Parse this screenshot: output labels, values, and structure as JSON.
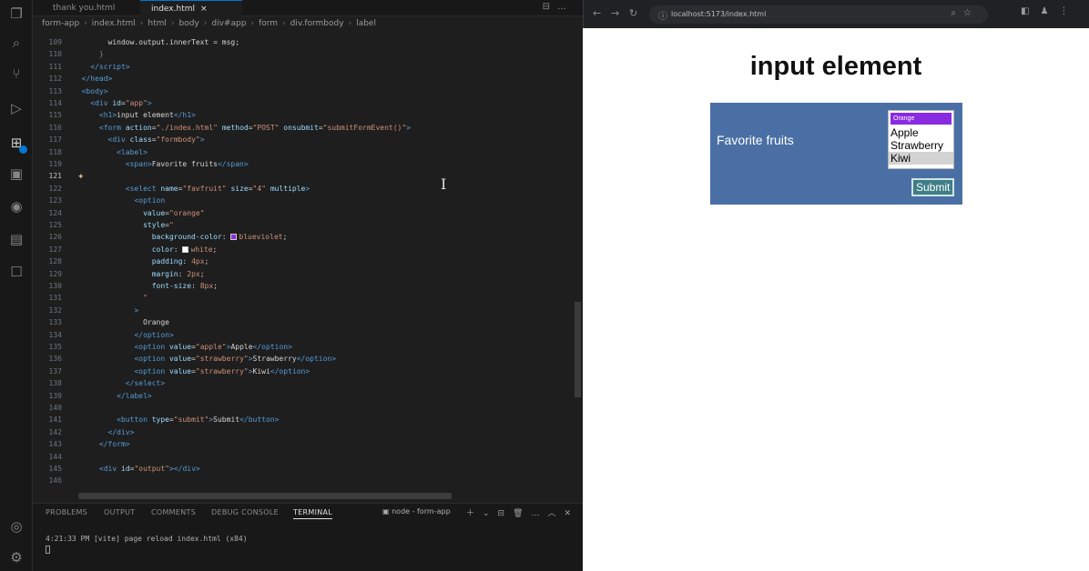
{
  "editor": {
    "tabs": [
      {
        "label": "thank you.html",
        "active": false
      },
      {
        "label": "index.html",
        "active": true
      }
    ],
    "breadcrumb": [
      "form-app",
      "index.html",
      "html",
      "body",
      "div#app",
      "form",
      "div.formbody",
      "label"
    ],
    "lines": [
      {
        "n": "109",
        "html": "        <span>window.output.innerText = msg;</span>"
      },
      {
        "n": "110",
        "html": "      <span class='pu'>}</span>"
      },
      {
        "n": "111",
        "html": "    <span class='tg'>&lt;/script&gt;</span>"
      },
      {
        "n": "112",
        "html": "  <span class='tg'>&lt;/head&gt;</span>"
      },
      {
        "n": "113",
        "html": "  <span class='tg'>&lt;body&gt;</span>"
      },
      {
        "n": "114",
        "html": "    <span class='tg'>&lt;div</span> <span class='at'>id</span>=<span class='st'>\"app\"</span><span class='tg'>&gt;</span>"
      },
      {
        "n": "115",
        "html": "      <span class='tg'>&lt;h1&gt;</span>input element<span class='tg'>&lt;/h1&gt;</span>"
      },
      {
        "n": "116",
        "html": "      <span class='tg'>&lt;form</span> <span class='at'>action</span>=<span class='st'>\"./index.html\"</span> <span class='at'>method</span>=<span class='st'>\"POST\"</span> <span class='at'>onsubmit</span>=<span class='st'>\"submitFormEvent()\"</span><span class='tg'>&gt;</span>"
      },
      {
        "n": "117",
        "html": "        <span class='tg'>&lt;div</span> <span class='at'>class</span>=<span class='st'>\"formbody\"</span><span class='tg'>&gt;</span>"
      },
      {
        "n": "118",
        "html": "          <span class='tg'>&lt;label&gt;</span>"
      },
      {
        "n": "119",
        "html": "            <span class='tg'>&lt;span&gt;</span>Favorite fruits<span class='tg'>&lt;/span&gt;</span>"
      },
      {
        "n": "121",
        "html": "",
        "cur": true
      },
      {
        "n": "122",
        "html": "            <span class='tg'>&lt;select</span> <span class='at'>name</span>=<span class='st'>\"favfruit\"</span> <span class='at'>size</span>=<span class='st'>\"4\"</span> <span class='at'>multiple</span><span class='tg'>&gt;</span>"
      },
      {
        "n": "123",
        "html": "              <span class='tg'>&lt;option</span>"
      },
      {
        "n": "124",
        "html": "                <span class='at'>value</span>=<span class='st'>\"orange\"</span>"
      },
      {
        "n": "125",
        "html": "                <span class='at'>style</span>=<span class='st'>\"</span>"
      },
      {
        "n": "126",
        "html": "                  <span class='at'>background-color</span>: <i class='sw' style='background:#8a2be2'></i><span class='st'>blueviolet</span>;"
      },
      {
        "n": "127",
        "html": "                  <span class='at'>color</span>: <i class='sw' style='background:#ffffff'></i><span class='st'>white</span>;"
      },
      {
        "n": "128",
        "html": "                  <span class='at'>padding</span>: <span class='st'>4px</span>;"
      },
      {
        "n": "129",
        "html": "                  <span class='at'>margin</span>: <span class='st'>2px</span>;"
      },
      {
        "n": "130",
        "html": "                  <span class='at'>font-size</span>: <span class='st'>8px</span>;"
      },
      {
        "n": "131",
        "html": "                <span class='st'>\"</span>"
      },
      {
        "n": "132",
        "html": "              <span class='tg'>&gt;</span>"
      },
      {
        "n": "133",
        "html": "                Orange"
      },
      {
        "n": "134",
        "html": "              <span class='tg'>&lt;/option&gt;</span>"
      },
      {
        "n": "135",
        "html": "              <span class='tg'>&lt;option</span> <span class='at'>value</span>=<span class='st'>\"apple\"</span><span class='tg'>&gt;</span>Apple<span class='tg'>&lt;/option&gt;</span>"
      },
      {
        "n": "136",
        "html": "              <span class='tg'>&lt;option</span> <span class='at'>value</span>=<span class='st'>\"strawberry\"</span><span class='tg'>&gt;</span>Strawberry<span class='tg'>&lt;/option&gt;</span>"
      },
      {
        "n": "137",
        "html": "              <span class='tg'>&lt;option</span> <span class='at'>value</span>=<span class='st'>\"strawberry\"</span><span class='tg'>&gt;</span>Kiwi<span class='tg'>&lt;/option&gt;</span>"
      },
      {
        "n": "138",
        "html": "            <span class='tg'>&lt;/select&gt;</span>"
      },
      {
        "n": "139",
        "html": "          <span class='tg'>&lt;/label&gt;</span>"
      },
      {
        "n": "140",
        "html": ""
      },
      {
        "n": "141",
        "html": "          <span class='tg'>&lt;button</span> <span class='at'>type</span>=<span class='st'>\"submit\"</span><span class='tg'>&gt;</span>Submit<span class='tg'>&lt;/button&gt;</span>"
      },
      {
        "n": "142",
        "html": "        <span class='tg'>&lt;/div&gt;</span>"
      },
      {
        "n": "143",
        "html": "      <span class='tg'>&lt;/form&gt;</span>"
      },
      {
        "n": "144",
        "html": ""
      },
      {
        "n": "145",
        "html": "      <span class='tg'>&lt;div</span> <span class='at'>id</span>=<span class='st'>\"output\"</span><span class='tg'>&gt;&lt;/div&gt;</span>"
      },
      {
        "n": "146",
        "html": ""
      }
    ],
    "panel": {
      "tabs": [
        "PROBLEMS",
        "OUTPUT",
        "COMMENTS",
        "DEBUG CONSOLE",
        "TERMINAL"
      ],
      "active_tab": "TERMINAL",
      "terminal_name": "node - form-app",
      "terminal_line": "4:21:33 PM [vite] page reload index.html (x84)"
    }
  },
  "browser": {
    "url": "localhost:5173/index.html",
    "page": {
      "heading": "input element",
      "label": "Favorite fruits",
      "options": [
        "Orange",
        "Apple",
        "Strawberry",
        "Kiwi"
      ],
      "selected_option": "Kiwi",
      "submit_label": "Submit"
    }
  },
  "colors": {
    "form_bg": "#4a6fa5",
    "orange_option_bg": "#8a2be2",
    "submit_bg": "#3f7e86"
  }
}
